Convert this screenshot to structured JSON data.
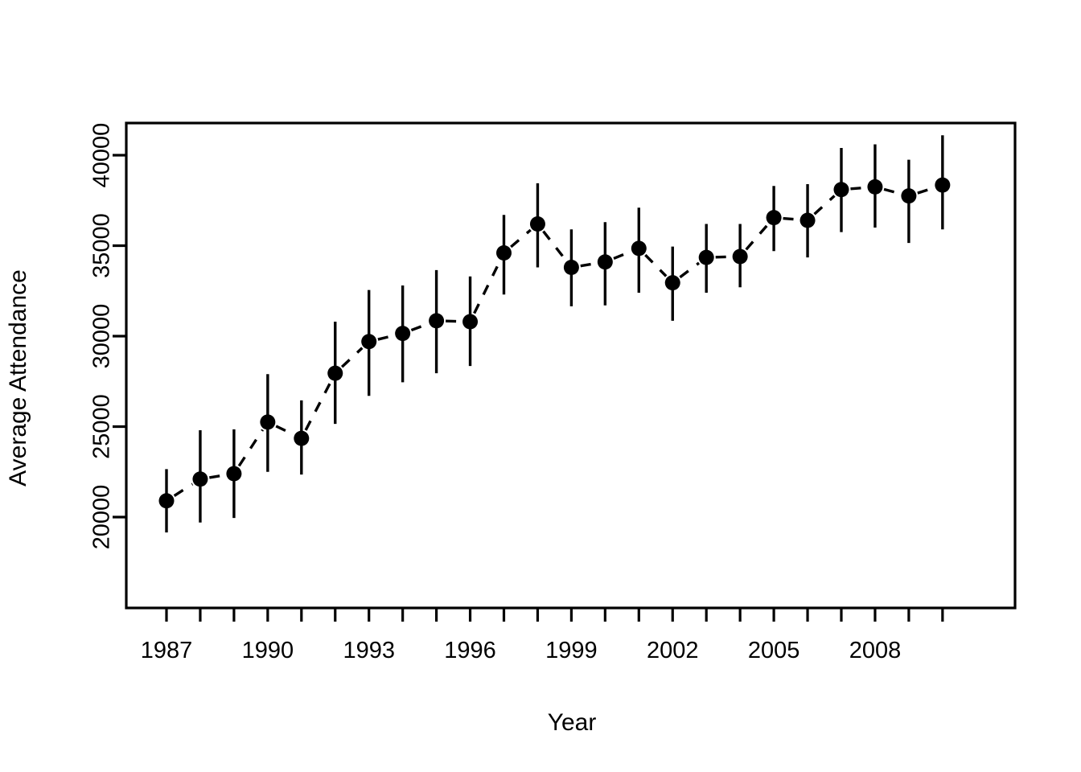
{
  "figure": {
    "background": "#ffffff",
    "foreground": "#000000"
  },
  "chart_data": {
    "type": "line",
    "title": "",
    "subtitle": "",
    "xlabel": "Year",
    "ylabel": "Average Attendance",
    "grid": false,
    "legend": null,
    "legend_position": "none",
    "line_style": "dashed",
    "marker": "filled-circle",
    "error_bars": "vertical",
    "xlim": [
      1986.3,
      2010.6
    ],
    "ylim": [
      18000,
      41500
    ],
    "xticks": [
      1987,
      1988,
      1989,
      1990,
      1991,
      1992,
      1993,
      1994,
      1995,
      1996,
      1997,
      1998,
      1999,
      2000,
      2001,
      2002,
      2003,
      2004,
      2005,
      2006,
      2007,
      2008,
      2009,
      2010
    ],
    "xtick_labels": [
      "1987",
      "",
      "",
      "1990",
      "",
      "",
      "1993",
      "",
      "",
      "1996",
      "",
      "",
      "1999",
      "",
      "",
      "2002",
      "",
      "",
      "2005",
      "",
      "",
      "2008",
      "",
      ""
    ],
    "yticks": [
      20000,
      25000,
      30000,
      35000,
      40000
    ],
    "ytick_labels": [
      "20000",
      "25000",
      "30000",
      "35000",
      "40000"
    ],
    "x": [
      1987,
      1988,
      1989,
      1990,
      1991,
      1992,
      1993,
      1994,
      1995,
      1996,
      1997,
      1998,
      1999,
      2000,
      2001,
      2002,
      2003,
      2004,
      2005,
      2006,
      2007,
      2008,
      2009,
      2010
    ],
    "values": [
      20900,
      22100,
      22400,
      25250,
      24350,
      27950,
      29700,
      30150,
      30850,
      30800,
      34600,
      36200,
      33800,
      34100,
      34850,
      32950,
      34350,
      34400,
      36550,
      36400,
      38100,
      38250,
      37750,
      38350
    ],
    "error_low": [
      19150,
      19700,
      19950,
      22500,
      22350,
      25150,
      26700,
      27450,
      27950,
      28350,
      32300,
      33800,
      31650,
      31700,
      32400,
      30850,
      32400,
      32700,
      34700,
      34350,
      35750,
      36000,
      35150,
      35900
    ],
    "error_high": [
      22650,
      24800,
      24850,
      27900,
      26450,
      30800,
      32550,
      32800,
      33650,
      33300,
      36700,
      38450,
      35900,
      36300,
      37100,
      34950,
      36200,
      36200,
      38300,
      38400,
      40400,
      40600,
      39750,
      41100
    ]
  }
}
